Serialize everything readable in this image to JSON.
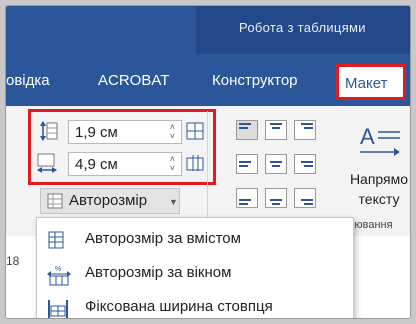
{
  "context": {
    "title": "Робота з таблицями"
  },
  "tabs": [
    {
      "label": "овідка"
    },
    {
      "label": "ACROBAT"
    },
    {
      "label": "Конструктор"
    },
    {
      "label": "Макет",
      "active": true
    }
  ],
  "cell_size": {
    "height_value": "1,9 см",
    "width_value": "4,9 см",
    "autosize_label": "Авторозмір"
  },
  "alignment": {
    "direction_label_1": "Напрямо",
    "direction_label_2": "тексту",
    "group_label": "івнювання"
  },
  "row_hint": "18",
  "dropdown": {
    "items": [
      {
        "label": "Авторозмір за вмістом",
        "icon": "autofit-contents-icon"
      },
      {
        "label": "Авторозмір за вікном",
        "icon": "autofit-window-icon"
      },
      {
        "label": "Фіксована ширина стовпця",
        "icon": "fixed-column-width-icon"
      }
    ]
  },
  "colors": {
    "ribbon_blue": "#2b579a",
    "highlight_red": "#e11b22",
    "icon_blue": "#2b579a"
  }
}
